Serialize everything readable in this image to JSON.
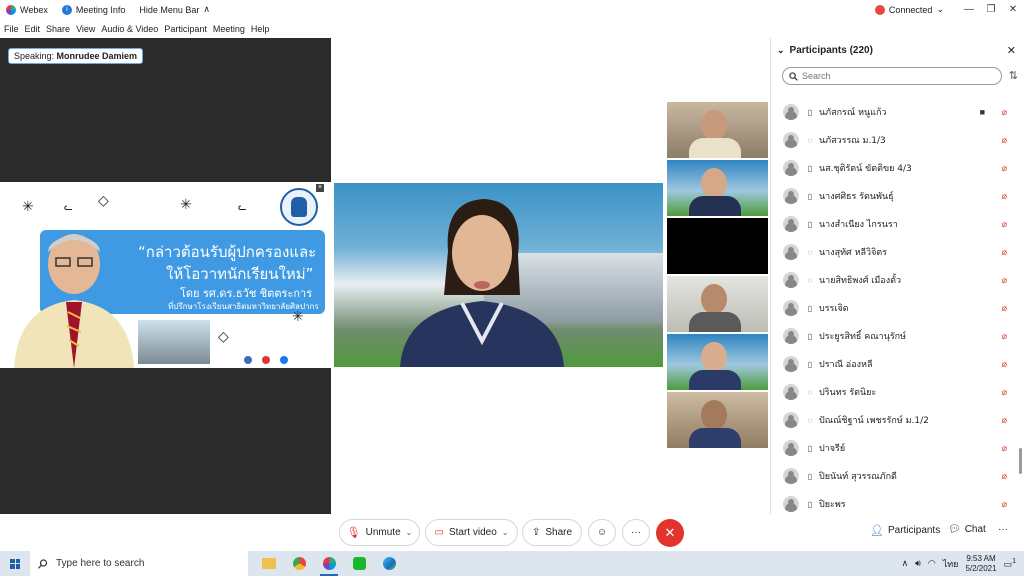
{
  "titlebar": {
    "app_name": "Webex",
    "meeting_info": "Meeting Info",
    "hide_menu": "Hide Menu Bar",
    "hide_menu_chevron": "∧",
    "status": "Connected",
    "status_chevron": "⌄"
  },
  "menubar": {
    "items": [
      "File",
      "Edit",
      "Share",
      "View",
      "Audio & Video",
      "Participant",
      "Meeting",
      "Help"
    ]
  },
  "speaking": {
    "prefix": "Speaking:",
    "name": "Monrudee Damiem"
  },
  "shared_content": {
    "line1": "“กล่าวต้อนรับผู้ปกครองและ",
    "line2": "ให้โอวาทนักเรียนใหม่”",
    "line3": "โดย รศ.ดร.ธวัช ชิตตระการ",
    "line4": "ที่ปรึกษาโรงเรียนสาธิตมหาวิทยาลัยศิลปากร"
  },
  "participants_panel": {
    "title": "Participants (220)",
    "search_placeholder": "Search",
    "participants": [
      {
        "name": "นภัสกรณ์ หนูแก้ว",
        "device": "phone",
        "camera": true
      },
      {
        "name": "นภัสวรรณ ม.1/3",
        "device": "headset",
        "camera": false
      },
      {
        "name": "นส.ชุติรัตน์ ขัตติขย 4/3",
        "device": "phone",
        "camera": false
      },
      {
        "name": "นางศศิธร รัตนพันธุ์",
        "device": "phone",
        "camera": false
      },
      {
        "name": "นางสำเนียง ไกรนรา",
        "device": "phone",
        "camera": false
      },
      {
        "name": "นางสุทัศ หลีวิจิตร",
        "device": "headset",
        "camera": false
      },
      {
        "name": "นายสิทธิพงศ์ เมืองตั้ว",
        "device": "headset",
        "camera": false
      },
      {
        "name": "บรรเจิด",
        "device": "phone",
        "camera": false
      },
      {
        "name": "ประยูรสิทธิ์ คณานุรักษ์",
        "device": "phone",
        "camera": false
      },
      {
        "name": "ปราณี อ่องหลี",
        "device": "phone",
        "camera": false
      },
      {
        "name": "ปรินทร รัตนิยะ",
        "device": "headset",
        "camera": false
      },
      {
        "name": "ปัณณ์ชิฐาน์ เพชรรักษ์ ม.1/2",
        "device": "headset",
        "camera": false
      },
      {
        "name": "ปาจรีย์",
        "device": "phone",
        "camera": false
      },
      {
        "name": "ปิยนันท์ สุวรรณภักดี",
        "device": "phone",
        "camera": false
      },
      {
        "name": "ปิยะพร",
        "device": "phone",
        "camera": false
      }
    ]
  },
  "controls": {
    "unmute": "Unmute",
    "start_video": "Start video",
    "share": "Share",
    "participants": "Participants",
    "chat": "Chat",
    "more": "···"
  },
  "taskbar": {
    "search_placeholder": "Type here to search",
    "language": "ไทย",
    "time": "9:53 AM",
    "date": "5/2/2021",
    "notification_count": "1"
  },
  "icons": {
    "mic_muted": "mic-off-icon",
    "video_off": "video-off-icon",
    "share": "share-icon",
    "reaction": "emoji-icon",
    "end": "close-icon",
    "search": "search-icon",
    "sort": "sort-icon"
  },
  "colors": {
    "accent": "#1b6bbf",
    "end_call": "#e3332d",
    "muted": "#d9372f",
    "share_blue": "#3f9ae3"
  }
}
